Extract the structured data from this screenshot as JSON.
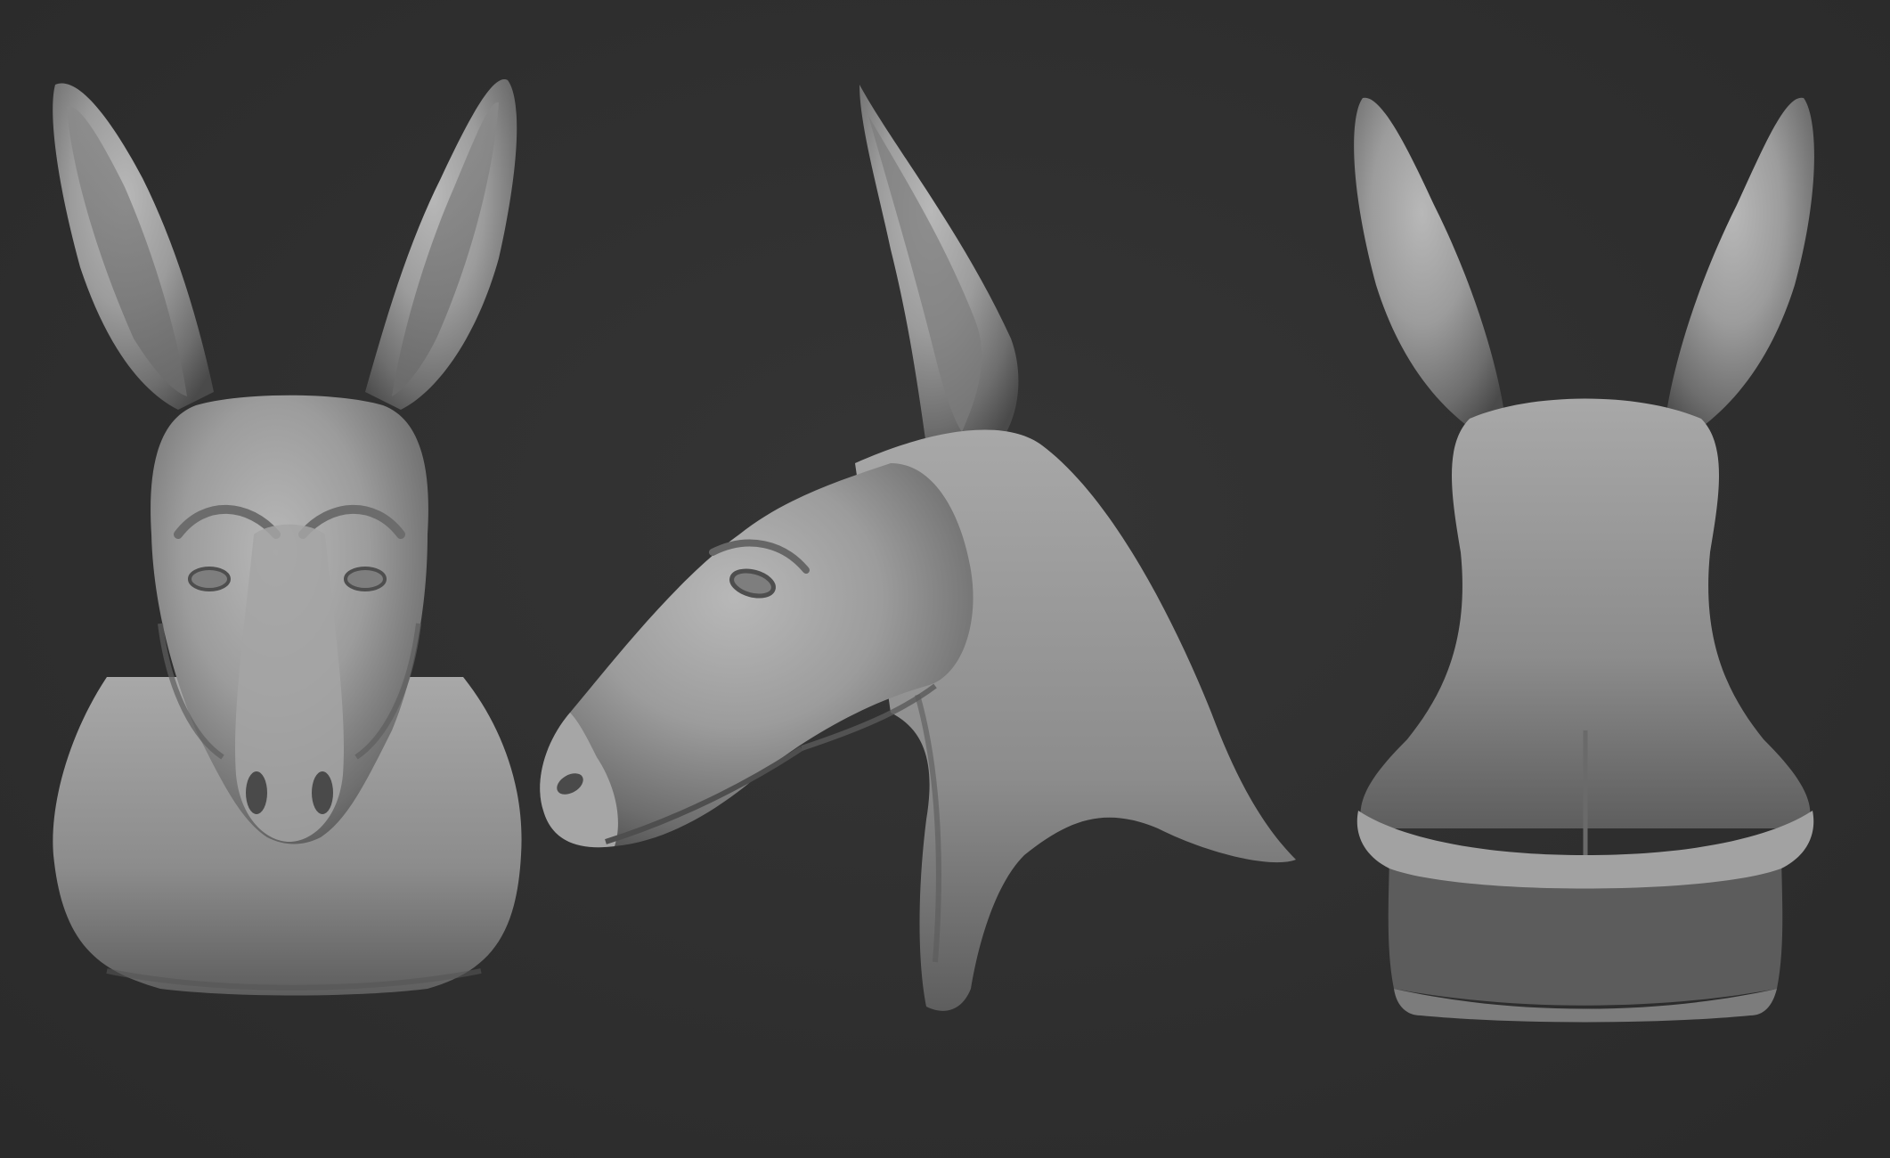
{
  "scene": {
    "background_color": "#2f2f2f",
    "material_color": "#9a9a9a",
    "views": [
      {
        "name": "front-view",
        "subject": "creature-head-bust"
      },
      {
        "name": "side-view",
        "subject": "creature-head-bust"
      },
      {
        "name": "back-view",
        "subject": "creature-head-bust"
      }
    ]
  }
}
